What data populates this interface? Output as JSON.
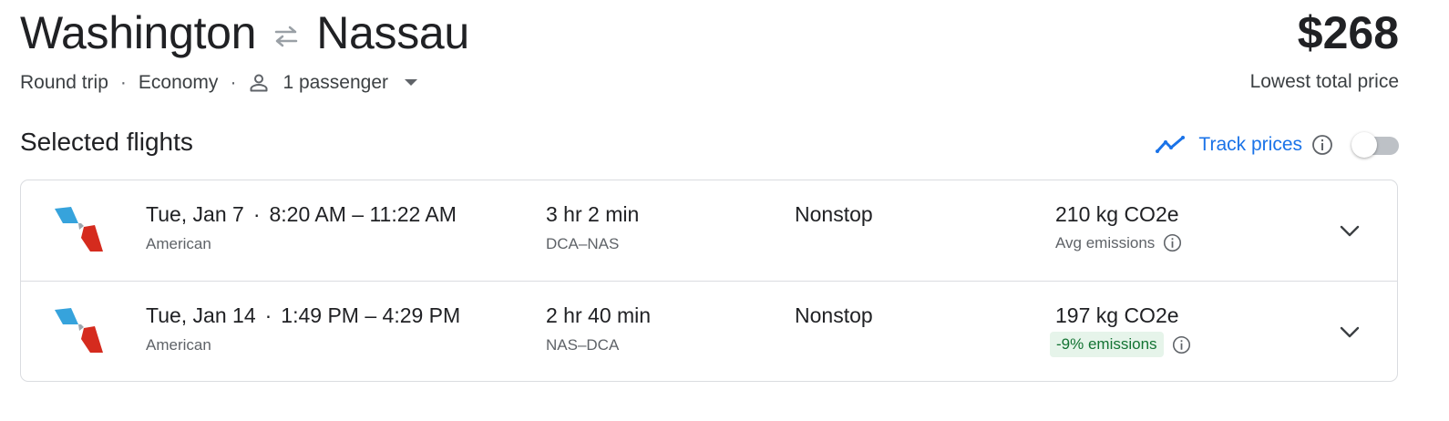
{
  "header": {
    "origin": "Washington",
    "destination": "Nassau",
    "swap_icon": "swap-arrows-icon",
    "trip_type": "Round trip",
    "cabin": "Economy",
    "passengers": "1 passenger",
    "separator": "·",
    "price": "$268",
    "price_caption": "Lowest total price"
  },
  "section": {
    "title": "Selected flights",
    "track_label": "Track prices",
    "track_enabled": false
  },
  "flights": [
    {
      "date": "Tue, Jan 7",
      "separator": "·",
      "times": "8:20 AM – 11:22 AM",
      "airline": "American",
      "duration": "3 hr 2 min",
      "route": "DCA–NAS",
      "stops": "Nonstop",
      "co2": "210 kg CO2e",
      "emissions": "Avg emissions"
    },
    {
      "date": "Tue, Jan 14",
      "separator": "·",
      "times": "1:49 PM – 4:29 PM",
      "airline": "American",
      "duration": "2 hr 40 min",
      "route": "NAS–DCA",
      "stops": "Nonstop",
      "co2": "197 kg CO2e",
      "emissions": "-9% emissions"
    }
  ],
  "colors": {
    "accent": "#1a73e8",
    "text": "#202124",
    "muted": "#5f6368",
    "border": "#dadce0",
    "badge_bg": "#e6f4ea",
    "badge_text": "#137333"
  }
}
